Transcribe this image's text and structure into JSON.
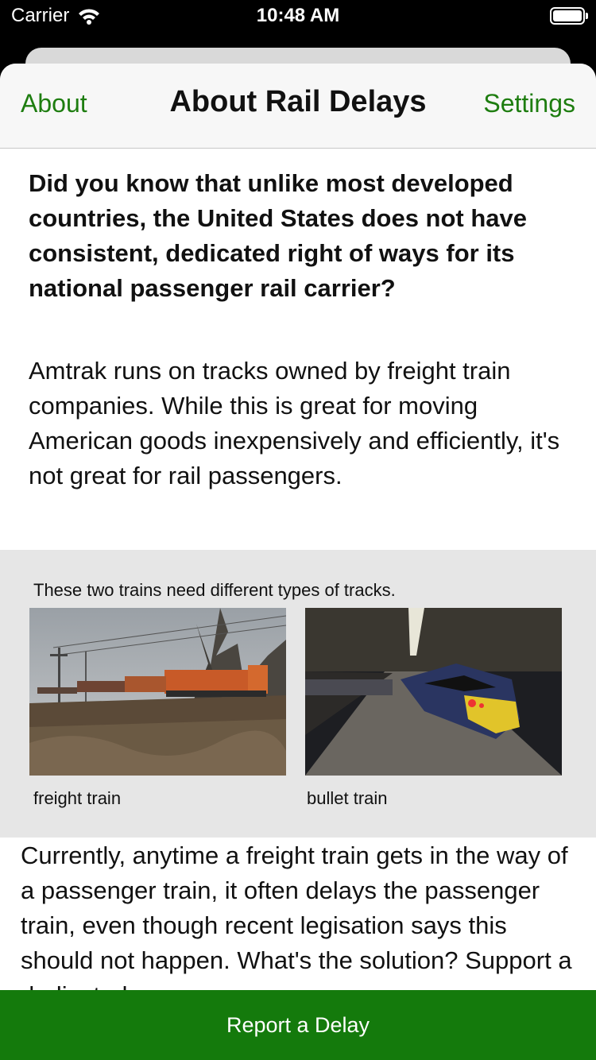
{
  "status_bar": {
    "carrier": "Carrier",
    "time": "10:48 AM"
  },
  "nav": {
    "left_label": "About",
    "title": "About Rail Delays",
    "right_label": "Settings"
  },
  "content": {
    "headline": "Did you know that unlike most developed countries, the United States does not have consistent, dedicated right of ways for its national passenger rail carrier?",
    "paragraph1": "Amtrak runs on tracks owned by freight train companies. While this is great for moving American goods inexpensively and efficiently, it's not great for rail passengers.",
    "gallery": {
      "caption": "These two trains need different types of tracks.",
      "photos": [
        {
          "label": "freight train"
        },
        {
          "label": "bullet train"
        }
      ]
    },
    "paragraph2": "Currently, anytime a freight train gets in the way of a passenger train, it often delays the passenger train, even though recent legisation says this should not happen. What's the solution? Support a dedicated"
  },
  "bottom_button": {
    "label": "Report a Delay"
  },
  "colors": {
    "accent": "#1e7d10",
    "button_bg": "#147a0c"
  }
}
